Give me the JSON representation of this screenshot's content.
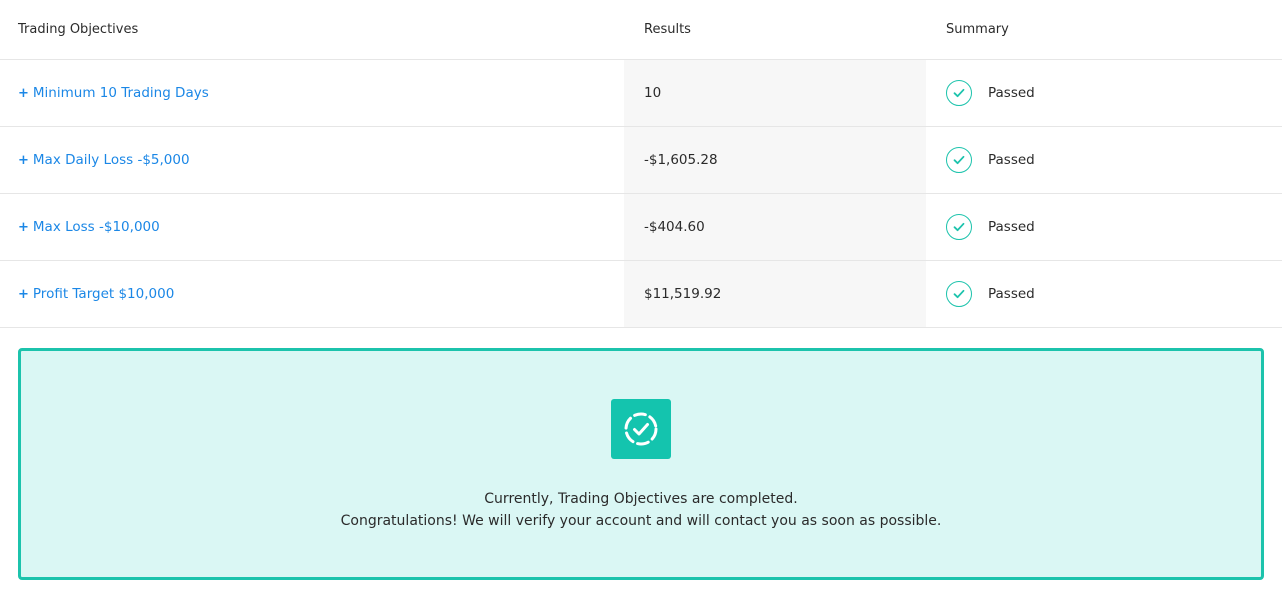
{
  "table": {
    "headers": {
      "objectives": "Trading Objectives",
      "results": "Results",
      "summary": "Summary"
    },
    "rows": [
      {
        "plus": "+",
        "objective": "Minimum 10 Trading Days",
        "result": "10",
        "status": "Passed"
      },
      {
        "plus": "+",
        "objective": "Max Daily Loss -$5,000",
        "result": "-$1,605.28",
        "status": "Passed"
      },
      {
        "plus": "+",
        "objective": "Max Loss -$10,000",
        "result": "-$404.60",
        "status": "Passed"
      },
      {
        "plus": "+",
        "objective": "Profit Target $10,000",
        "result": "$11,519.92",
        "status": "Passed"
      }
    ]
  },
  "banner": {
    "icon": "dashed-circle-check-icon",
    "line1": "Currently, Trading Objectives are completed.",
    "line2": "Congratulations! We will verify your account and will contact you as soon as possible."
  },
  "colors": {
    "accent_teal": "#1cc3ac",
    "banner_bg": "#daf7f4",
    "link_blue": "#1b87e6",
    "results_bg": "#f7f7f7"
  }
}
